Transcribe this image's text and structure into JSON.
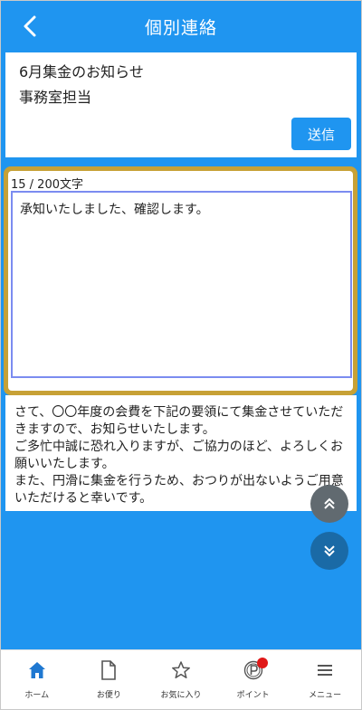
{
  "header": {
    "title": "個別連絡"
  },
  "message_card": {
    "line1": "6月集金のお知らせ",
    "line2": "事務室担当",
    "send_label": "送信"
  },
  "reply": {
    "counter": "15 / 200文字",
    "text": "承知いたしました、確認します。"
  },
  "body_text": {
    "p1": "さて、〇〇年度の会費を下記の要領にて集金させていただきますので、お知らせいたします。",
    "p2": "ご多忙中誠に恐れ入りますが、ご協力のほど、よろしくお願いいたします。",
    "p3": "また、円滑に集金を行うため、おつりが出ないようご用意いただけると幸いです。"
  },
  "tabs": [
    {
      "label": "ホーム",
      "icon": "home-icon"
    },
    {
      "label": "お便り",
      "icon": "document-icon"
    },
    {
      "label": "お気に入り",
      "icon": "star-icon"
    },
    {
      "label": "ポイント",
      "icon": "point-icon"
    },
    {
      "label": "メニュー",
      "icon": "menu-icon"
    }
  ],
  "colors": {
    "primary": "#1f95f0",
    "highlight_border": "#c7a136",
    "badge": "#e01818"
  }
}
